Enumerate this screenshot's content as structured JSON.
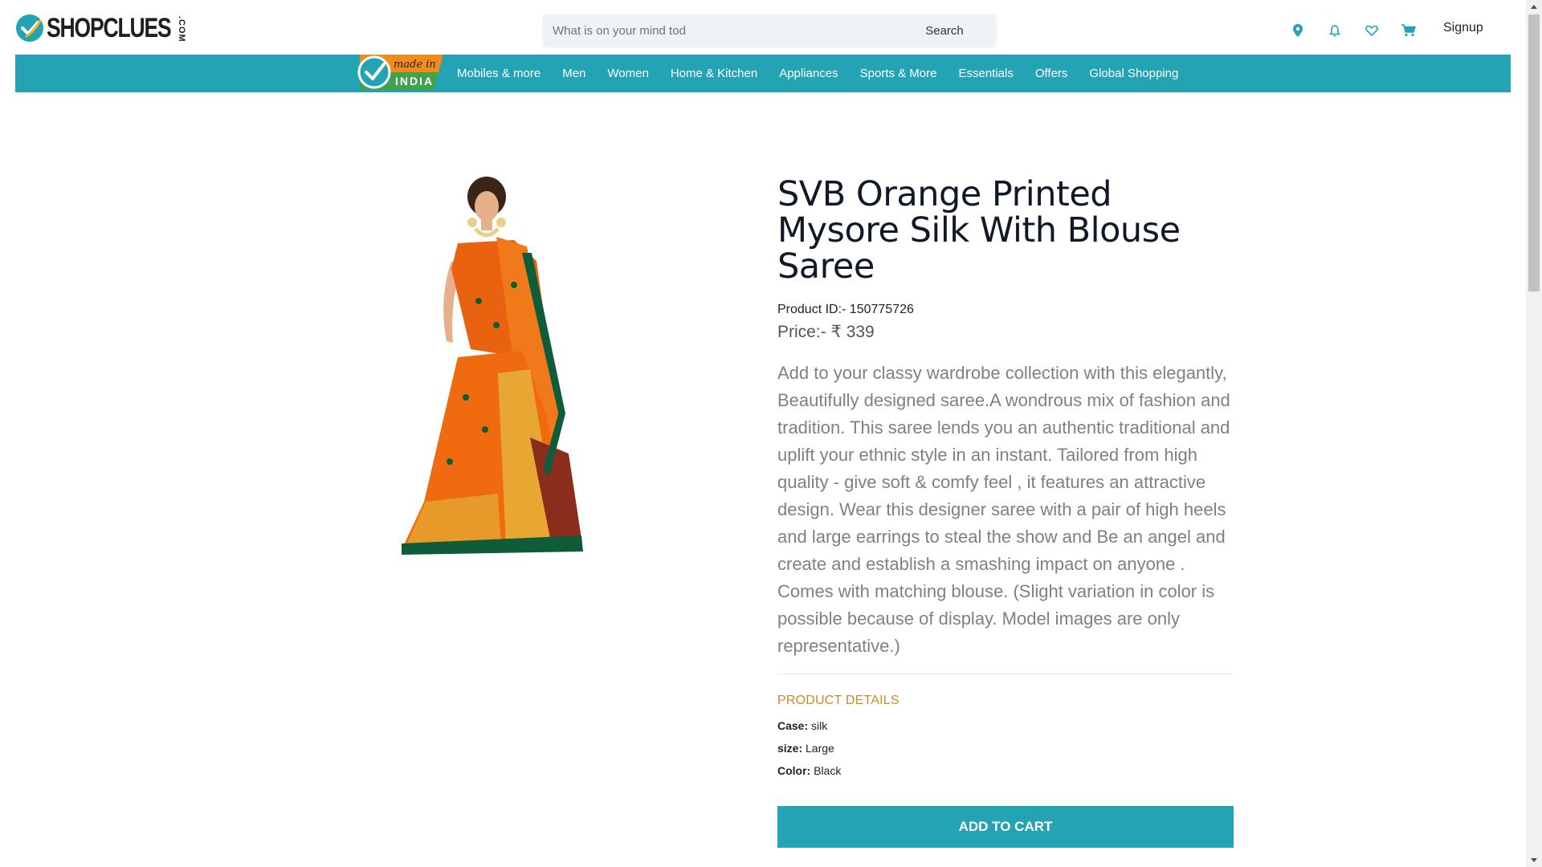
{
  "header": {
    "logo_text": "SHOPCLUES",
    "logo_suffix": ".COM",
    "search_placeholder": "What is on your mind today?",
    "search_button": "Search",
    "icons": [
      "location-pin-icon",
      "bell-icon",
      "heart-icon",
      "cart-icon"
    ],
    "signup": "Signup"
  },
  "nav": {
    "badge_top": "made in",
    "badge_bottom": "INDIA",
    "items": [
      "Mobiles & more",
      "Men",
      "Women",
      "Home & Kitchen",
      "Appliances",
      "Sports & More",
      "Essentials",
      "Offers",
      "Global Shopping"
    ]
  },
  "product": {
    "title": "SVB Orange Printed Mysore Silk With Blouse Saree",
    "product_id": "Product ID:- 150775726",
    "price": "Price:- ₹ 339",
    "description": "Add to your classy wardrobe collection with this elegantly, Beautifully designed saree.A wondrous mix of fashion and tradition. This saree lends you an authentic traditional and uplift your ethnic style in an instant. Tailored from high quality - give soft & comfy feel , it features an attractive design. Wear this designer saree with a pair of high heels and large earrings to steal the show and Be an angel and create and establish a smashing impact on anyone . Comes with matching blouse. (Slight variation in color is possible because of display. Model images are only representative.)",
    "details_heading": "PRODUCT DETAILS",
    "specs": [
      {
        "label": "Case:",
        "value": " silk"
      },
      {
        "label": "size:",
        "value": " Large"
      },
      {
        "label": "Color:",
        "value": " Black"
      }
    ],
    "add_to_cart": "ADD TO CART"
  },
  "colors": {
    "brand": "#24a3b5",
    "details_heading": "#cc8a2a",
    "badge_orange": "#f28b1c",
    "badge_green": "#3fa34d"
  }
}
